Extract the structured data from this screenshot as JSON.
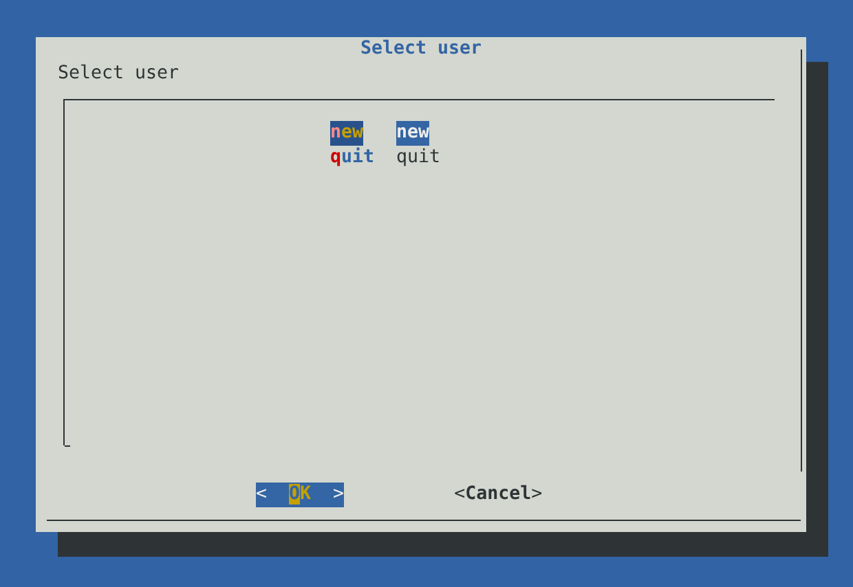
{
  "dialog": {
    "title": "Select user",
    "prompt": "Select user"
  },
  "menu": {
    "items": [
      {
        "tag": "new",
        "description": "new",
        "selected": true
      },
      {
        "tag": "quit",
        "description": "quit",
        "selected": false
      }
    ]
  },
  "buttons": [
    {
      "open": "<",
      "label": "OK",
      "close": ">",
      "selected": true
    },
    {
      "open": "<",
      "label": "Cancel",
      "close": ">",
      "selected": false
    }
  ]
}
